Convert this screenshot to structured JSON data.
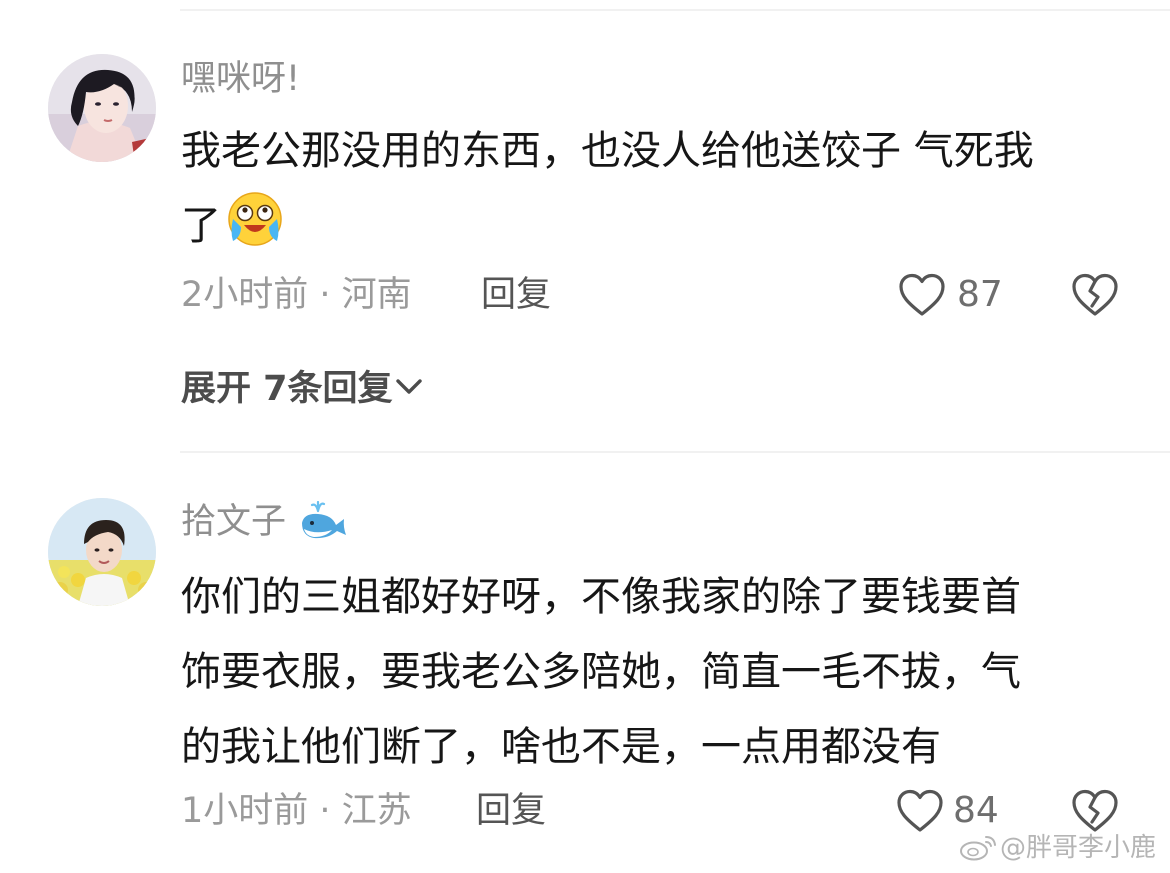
{
  "comments": [
    {
      "username": "嘿咪呀!",
      "content_lines": [
        "我老公那没用的东西，也没人给他送饺子 气死我",
        "了"
      ],
      "emoji_icon": "crying-laughing-emoji-icon",
      "meta": "2小时前 · 河南",
      "reply_label": "回复",
      "like_count": "87",
      "expand_label": "展开 7条回复"
    },
    {
      "username": "拾文子",
      "badge_icon": "whale-icon",
      "content_lines": [
        "你们的三姐都好好呀，不像我家的除了要钱要首",
        "饰要衣服，要我老公多陪她，简直一毛不拔，气",
        "的我让他们断了，啥也不是，一点用都没有"
      ],
      "meta": "1小时前 · 江苏",
      "reply_label": "回复",
      "like_count": "84"
    }
  ],
  "watermark": "@胖哥李小鹿",
  "colors": {
    "text": "#161616",
    "username": "#8f8f8f",
    "meta": "#9a9a9a",
    "divider": "#f1f1f1"
  }
}
